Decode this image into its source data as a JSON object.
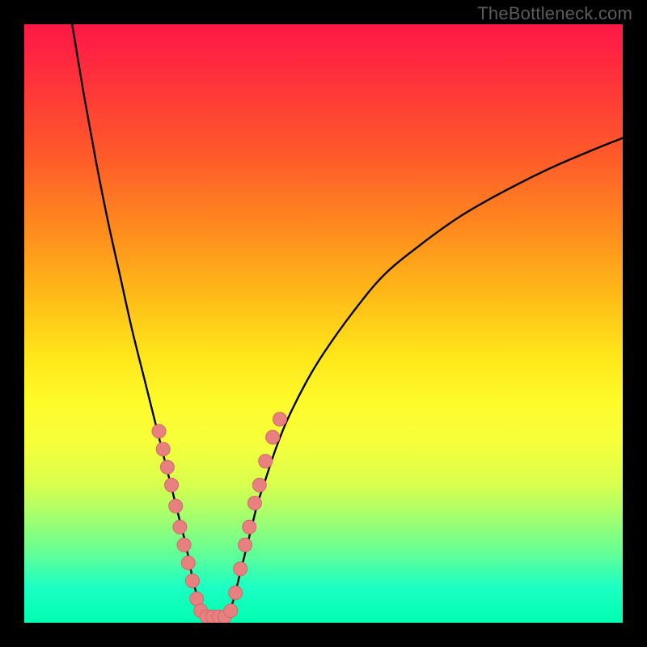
{
  "watermark": "TheBottleneck.com",
  "colors": {
    "frame": "#000000",
    "curve": "#000000",
    "dot_fill": "#e88080",
    "dot_stroke": "#d06a6a"
  },
  "chart_data": {
    "type": "line",
    "title": "",
    "xlabel": "",
    "ylabel": "",
    "xlim": [
      0,
      100
    ],
    "ylim": [
      0,
      100
    ],
    "grid": false,
    "legend": false,
    "series": [
      {
        "name": "left-curve",
        "x": [
          8,
          10,
          12,
          14,
          16,
          18,
          20,
          22,
          23,
          24,
          25,
          26,
          27,
          28,
          29,
          30
        ],
        "y": [
          100,
          88,
          77,
          67,
          58,
          49,
          41,
          33,
          29,
          25,
          21,
          17,
          13,
          8,
          4,
          1
        ]
      },
      {
        "name": "right-curve",
        "x": [
          34,
          35,
          36,
          37,
          38,
          39,
          40,
          42,
          44,
          47,
          50,
          55,
          60,
          66,
          73,
          80,
          88,
          95,
          100
        ],
        "y": [
          1,
          4,
          8,
          12,
          16,
          20,
          23,
          29,
          34,
          40,
          45,
          52,
          58,
          63,
          68,
          72,
          76,
          79,
          81
        ]
      }
    ],
    "dots": [
      {
        "x": 22.5,
        "y": 32
      },
      {
        "x": 23.2,
        "y": 29
      },
      {
        "x": 23.9,
        "y": 26
      },
      {
        "x": 24.6,
        "y": 23
      },
      {
        "x": 25.3,
        "y": 19.5
      },
      {
        "x": 26.0,
        "y": 16
      },
      {
        "x": 26.7,
        "y": 13
      },
      {
        "x": 27.4,
        "y": 10
      },
      {
        "x": 28.1,
        "y": 7
      },
      {
        "x": 28.8,
        "y": 4
      },
      {
        "x": 29.5,
        "y": 2
      },
      {
        "x": 30.5,
        "y": 1
      },
      {
        "x": 31.5,
        "y": 1
      },
      {
        "x": 32.5,
        "y": 1
      },
      {
        "x": 33.5,
        "y": 1
      },
      {
        "x": 34.5,
        "y": 2
      },
      {
        "x": 35.3,
        "y": 5
      },
      {
        "x": 36.1,
        "y": 9
      },
      {
        "x": 36.9,
        "y": 13
      },
      {
        "x": 37.6,
        "y": 16
      },
      {
        "x": 38.5,
        "y": 20
      },
      {
        "x": 39.3,
        "y": 23
      },
      {
        "x": 40.3,
        "y": 27
      },
      {
        "x": 41.5,
        "y": 31
      },
      {
        "x": 42.7,
        "y": 34
      }
    ]
  }
}
